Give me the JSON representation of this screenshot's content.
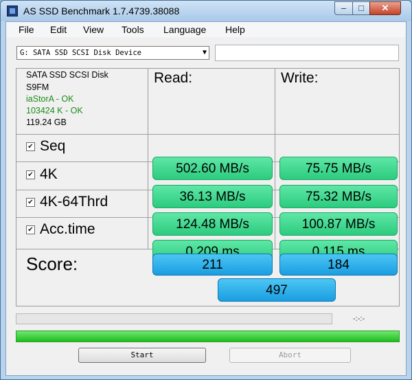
{
  "window": {
    "title": "AS SSD Benchmark 1.7.4739.38088",
    "controls": {
      "minimize": "–",
      "maximize": "□",
      "close": "✕"
    }
  },
  "menu": [
    "File",
    "Edit",
    "View",
    "Tools",
    "Language",
    "Help"
  ],
  "device_select": {
    "value": "G: SATA SSD SCSI Disk Device"
  },
  "drive_info": {
    "model": "SATA SSD SCSI Disk",
    "firmware": "S9FM",
    "driver": "iaStorA - OK",
    "alignment": "103424 K - OK",
    "size": "119.24 GB",
    "ok_color": "#1a8c1a"
  },
  "headers": {
    "read": "Read:",
    "write": "Write:"
  },
  "rows": [
    {
      "label": "Seq",
      "checked": true,
      "read": "502.60 MB/s",
      "write": "75.75 MB/s"
    },
    {
      "label": "4K",
      "checked": true,
      "read": "36.13 MB/s",
      "write": "75.32 MB/s"
    },
    {
      "label": "4K-64Thrd",
      "checked": true,
      "read": "124.48 MB/s",
      "write": "100.87 MB/s"
    },
    {
      "label": "Acc.time",
      "checked": true,
      "read": "0.209 ms",
      "write": "0.115 ms"
    }
  ],
  "score": {
    "label": "Score:",
    "read": "211",
    "write": "184",
    "total": "497"
  },
  "progress": {
    "fraction": 0,
    "time": "-:-:-"
  },
  "total_progress": {
    "fraction": 1
  },
  "buttons": {
    "start": "Start",
    "abort": "Abort"
  },
  "icons": {
    "app": "disk-benchmark-icon",
    "dropdown": "chevron-down-icon",
    "checkbox": "check-icon"
  },
  "colors": {
    "result_fill": "#3fd88f",
    "score_fill": "#2ab2ec",
    "progress_green": "#22c022"
  }
}
